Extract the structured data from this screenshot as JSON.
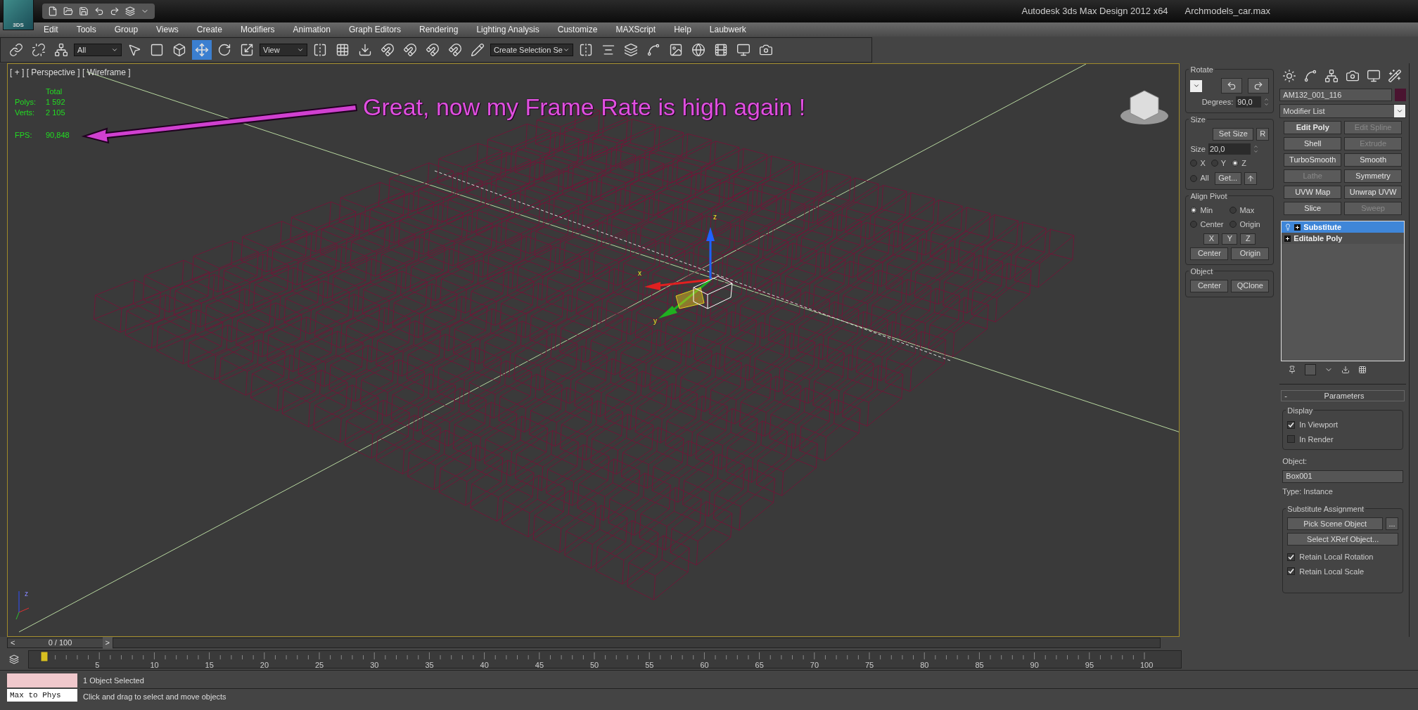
{
  "title_bar": {
    "logo_label": "3DS",
    "app_title": "Autodesk 3ds Max Design 2012 x64",
    "file_name": "Archmodels_car.max"
  },
  "menu": [
    "Edit",
    "Tools",
    "Group",
    "Views",
    "Create",
    "Modifiers",
    "Animation",
    "Graph Editors",
    "Rendering",
    "Lighting Analysis",
    "Customize",
    "MAXScript",
    "Help",
    "Laubwerk"
  ],
  "toolbar": {
    "selection_filter": "All",
    "reference_coord": "View",
    "named_selection": "Create Selection Se"
  },
  "viewport": {
    "label": "[ + ] [ Perspective ] [ Wireframe ]",
    "stats": {
      "header": "Total",
      "rows": [
        {
          "label": "Polys:",
          "value": "1 592"
        },
        {
          "label": "Verts:",
          "value": "2 105"
        }
      ],
      "fps_label": "FPS:",
      "fps_value": "90,848"
    },
    "annotation": "Great, now my Frame Rate is high again !",
    "gizmo_labels": [
      "x",
      "y",
      "z"
    ],
    "corner_axis_label": "z"
  },
  "tools_panel": {
    "rotate": {
      "title": "Rotate",
      "degrees_label": "Degrees:",
      "degrees_value": "90,0"
    },
    "size": {
      "title": "Size",
      "set_size": "Set Size",
      "reset": "R",
      "size_label": "Size",
      "size_value": "20,0",
      "axes": [
        {
          "label": "X",
          "selected": false
        },
        {
          "label": "Y",
          "selected": false
        },
        {
          "label": "Z",
          "selected": true
        },
        {
          "label": "All",
          "selected": false
        }
      ],
      "get": "Get..."
    },
    "align_pivot": {
      "title": "Align Pivot",
      "options": [
        {
          "label": "Min",
          "selected": true
        },
        {
          "label": "Max",
          "selected": false
        },
        {
          "label": "Center",
          "selected": false
        },
        {
          "label": "Origin",
          "selected": false
        }
      ],
      "axis_buttons": [
        "X",
        "Y",
        "Z"
      ],
      "buttons": [
        "Center",
        "Origin"
      ]
    },
    "object": {
      "title": "Object",
      "buttons": [
        "Center",
        "QClone"
      ]
    }
  },
  "command_panel": {
    "object_name": "AM132_001_116",
    "modifier_list": "Modifier List",
    "modifier_buttons": [
      {
        "label": "Edit Poly",
        "disabled": false,
        "highlighted": true
      },
      {
        "label": "Edit Spline",
        "disabled": true,
        "highlighted": false
      },
      {
        "label": "Shell",
        "disabled": false,
        "highlighted": false
      },
      {
        "label": "Extrude",
        "disabled": true,
        "highlighted": false
      },
      {
        "label": "TurboSmooth",
        "disabled": false,
        "highlighted": false
      },
      {
        "label": "Smooth",
        "disabled": false,
        "highlighted": false
      },
      {
        "label": "Lathe",
        "disabled": true,
        "highlighted": false
      },
      {
        "label": "Symmetry",
        "disabled": false,
        "highlighted": false
      },
      {
        "label": "UVW Map",
        "disabled": false,
        "highlighted": false
      },
      {
        "label": "Unwrap UVW",
        "disabled": false,
        "highlighted": false
      },
      {
        "label": "Slice",
        "disabled": false,
        "highlighted": false
      },
      {
        "label": "Sweep",
        "disabled": true,
        "highlighted": false
      }
    ],
    "stack": [
      {
        "label": "Substitute",
        "kind": "modifier",
        "selected": true
      },
      {
        "label": "Editable Poly",
        "kind": "base",
        "selected": false
      }
    ],
    "parameters": {
      "collapse": "-",
      "title": "Parameters",
      "display_title": "Display",
      "display": [
        {
          "label": "In Viewport",
          "checked": true
        },
        {
          "label": "In Render",
          "checked": false
        }
      ],
      "object_label": "Object:",
      "object_value": "Box001",
      "type": "Type: Instance",
      "assignment_title": "Substitute Assignment",
      "pick": "Pick Scene Object",
      "more": "...",
      "xref": "Select XRef Object...",
      "options": [
        {
          "label": "Retain Local Rotation",
          "checked": true
        },
        {
          "label": "Retain Local Scale",
          "checked": true
        }
      ]
    }
  },
  "timeline": {
    "level": 0,
    "prev": "<",
    "position": "0 / 100",
    "next": ">",
    "labels": [
      "5",
      "10",
      "15",
      "20",
      "25",
      "30",
      "35",
      "40",
      "45",
      "50",
      "55",
      "60",
      "65",
      "70",
      "75",
      "80",
      "85",
      "90",
      "95",
      "100"
    ]
  },
  "status_bar": {
    "listener": "Max to Phys",
    "selection": "1 Object Selected",
    "prompt": "Click and drag to select and move objects"
  }
}
